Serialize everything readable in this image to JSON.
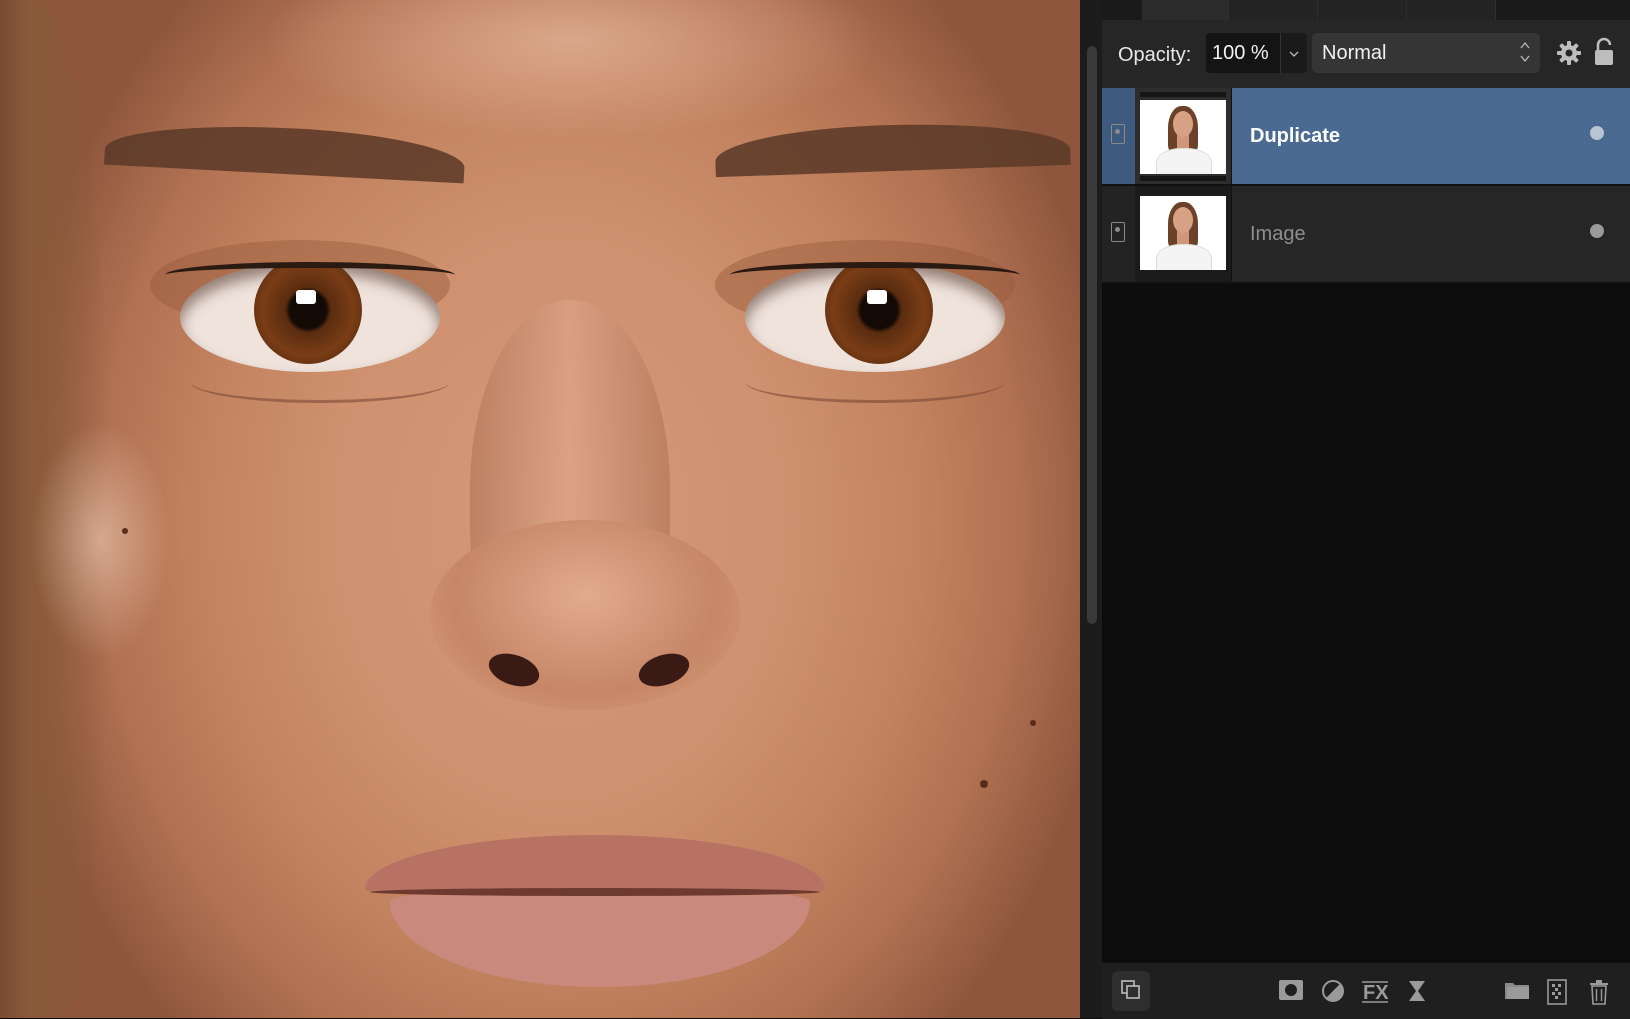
{
  "canvas": {
    "subject": "portrait-closeup"
  },
  "layers_panel": {
    "toolbar": {
      "opacity_label": "Opacity:",
      "opacity_value": "100 %",
      "blend_mode": "Normal"
    },
    "layers": [
      {
        "name": "Duplicate",
        "selected": true
      },
      {
        "name": "Image",
        "selected": false
      }
    ],
    "icons": {
      "settings": "gear-icon",
      "lock": "lock-icon",
      "mask": "mask-icon",
      "adjustment": "adjustment-icon",
      "fx": "fx-icon",
      "live-filter": "hourglass-icon",
      "group": "folder-icon",
      "pixel-layer": "pixel-layer-icon",
      "delete": "trash-icon",
      "arrange": "arrange-icon"
    },
    "colors": {
      "selected_row": "#4a6a92",
      "panel_bg": "#1f1f1f"
    }
  }
}
